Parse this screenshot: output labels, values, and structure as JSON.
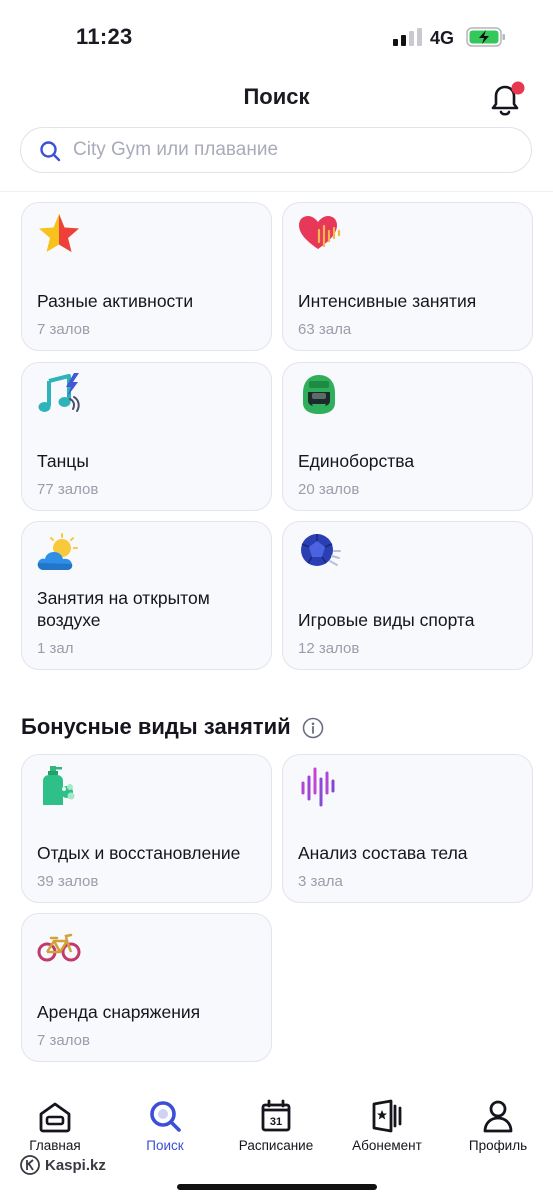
{
  "status": {
    "time": "11:23",
    "network": "4G"
  },
  "header": {
    "title": "Поиск",
    "has_notification": true
  },
  "search": {
    "placeholder": "City Gym или плавание",
    "value": ""
  },
  "categories": [
    {
      "title": "Разные активности",
      "count": "7 залов",
      "icon": "star-icon"
    },
    {
      "title": "Интенсивные занятия",
      "count": "63 зала",
      "icon": "heartbeat-icon"
    },
    {
      "title": "Танцы",
      "count": "77 залов",
      "icon": "music-note-icon"
    },
    {
      "title": "Единоборства",
      "count": "20 залов",
      "icon": "boxing-helmet-icon"
    },
    {
      "title": "Занятия на открытом воздухе",
      "count": "1 зал",
      "icon": "sun-cloud-icon"
    },
    {
      "title": "Игровые виды спорта",
      "count": "12 залов",
      "icon": "ball-icon"
    }
  ],
  "bonus": {
    "title": "Бонусные виды занятий",
    "items": [
      {
        "title": "Отдых и восстановление",
        "count": "39 залов",
        "icon": "soap-bottle-icon"
      },
      {
        "title": "Анализ состава тела",
        "count": "3 зала",
        "icon": "sound-wave-icon"
      },
      {
        "title": "Аренда снаряжения",
        "count": "7 залов",
        "icon": "bicycle-icon"
      }
    ]
  },
  "tabbar": [
    {
      "label": "Главная",
      "icon": "home-icon",
      "active": false
    },
    {
      "label": "Поиск",
      "icon": "search-icon",
      "active": true
    },
    {
      "label": "Расписание",
      "icon": "calendar-icon",
      "active": false
    },
    {
      "label": "Абонемент",
      "icon": "membership-card-icon",
      "active": false
    },
    {
      "label": "Профиль",
      "icon": "profile-icon",
      "active": false
    }
  ],
  "calendar_day": "31",
  "watermark": "Kaspi.kz",
  "colors": {
    "accent": "#3b4fd8",
    "notification": "#e8384f",
    "card_bg": "#f8f9fd",
    "muted_text": "#9b9dab"
  }
}
